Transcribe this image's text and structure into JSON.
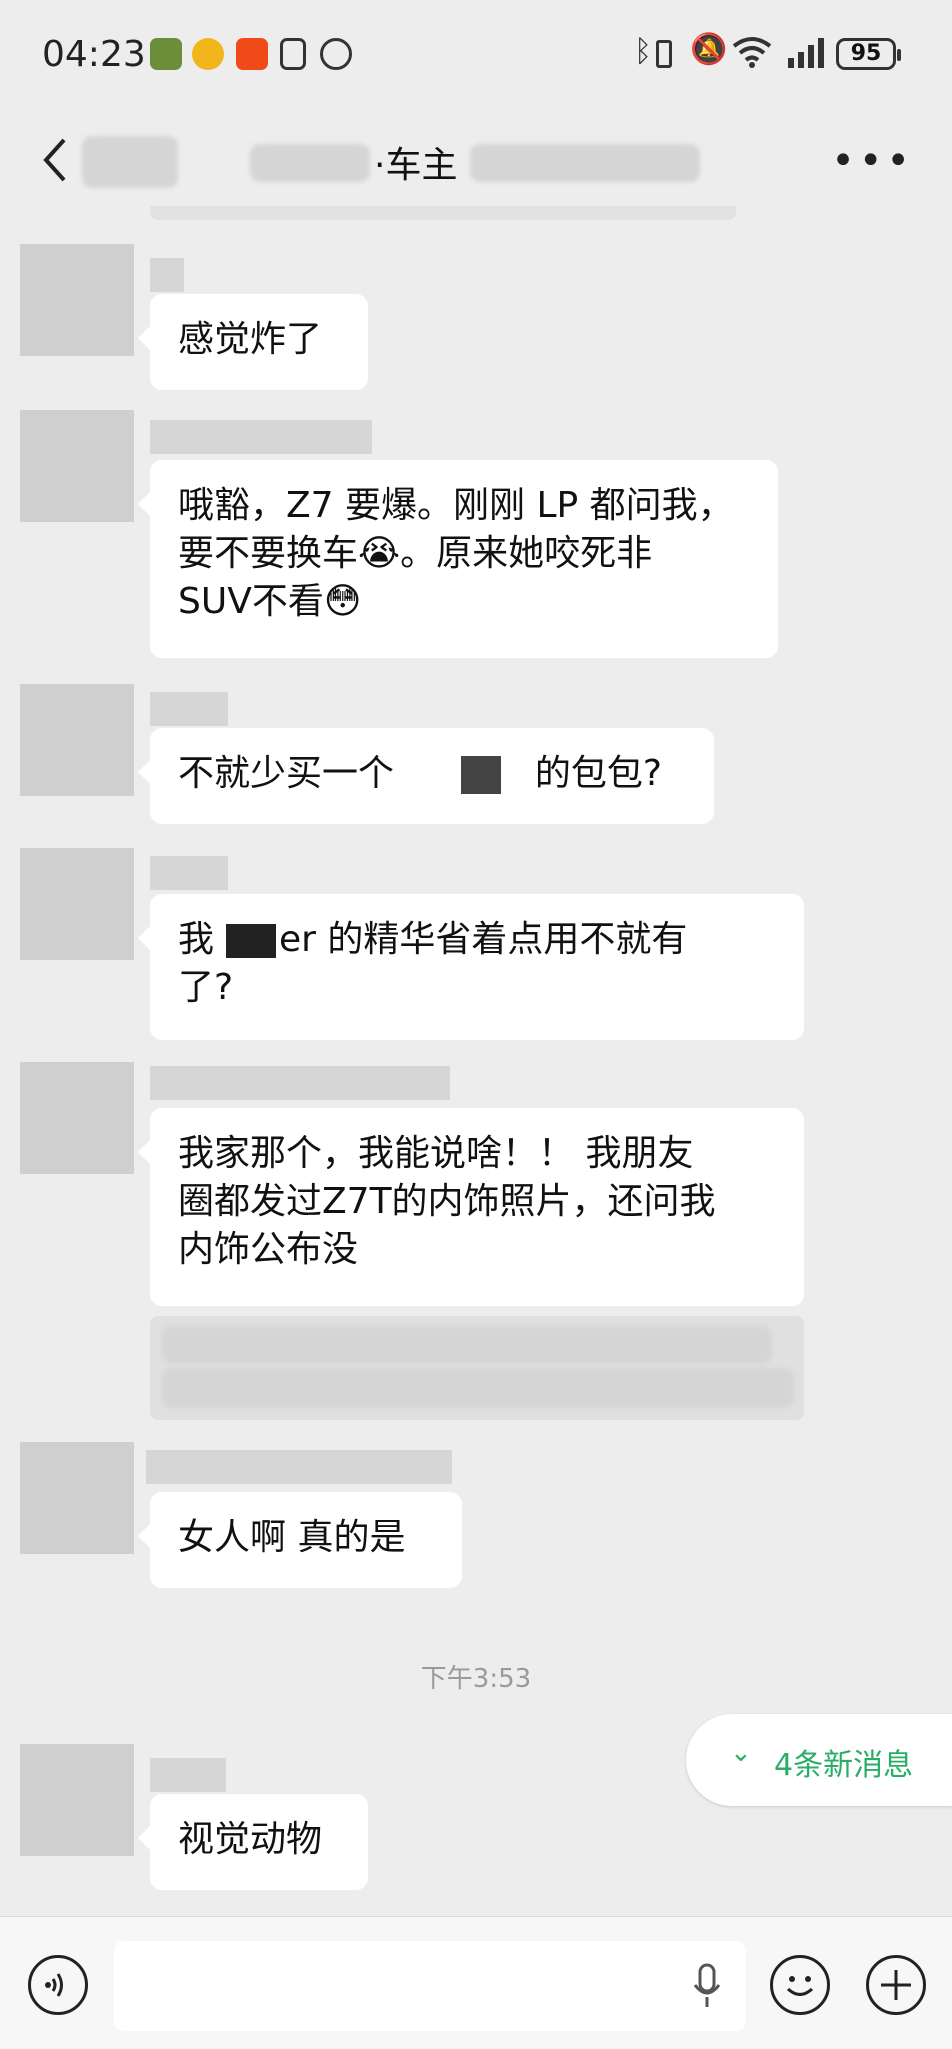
{
  "status_bar": {
    "time": "04:23",
    "battery": "95",
    "icons": [
      "app-icon",
      "weibo-icon",
      "taobao-icon",
      "nfc-icon",
      "alarm-icon",
      "bluetooth-icon",
      "vibrate-icon",
      "mute-icon",
      "wifi-icon",
      "signal-icon"
    ]
  },
  "header": {
    "title": "·车主",
    "back_icon": "chevron-left-icon",
    "more_icon": "more-icon"
  },
  "messages": [
    {
      "text": "感觉炸了"
    },
    {
      "lines": [
        "哦豁，Z7 要爆。刚刚 LP 都问我，",
        "要不要换车😭。原来她咬死非",
        "SUV不看😳"
      ]
    },
    {
      "text_before": "不就少买一个",
      "text_after": "的包包?"
    },
    {
      "lines": [
        "我 La    er 的精华省着点用不就有",
        "了?"
      ]
    },
    {
      "lines": [
        "我家那个，我能说啥！！ 我朋友",
        "圈都发过Z7T的内饰照片，还问我",
        "内饰公布没"
      ]
    },
    {
      "text": "女人啊 真的是"
    },
    {
      "text": "视觉动物"
    }
  ],
  "timestamp": "下午3:53",
  "new_messages": {
    "label": "4条新消息",
    "icon": "double-chevron-down-icon"
  },
  "input_bar": {
    "voice_icon": "voice-icon",
    "mic_icon": "mic-icon",
    "emoji_icon": "emoji-icon",
    "plus_icon": "plus-icon"
  },
  "colors": {
    "background": "#ededed",
    "bubble": "#ffffff",
    "accent_green": "#2aae67"
  }
}
